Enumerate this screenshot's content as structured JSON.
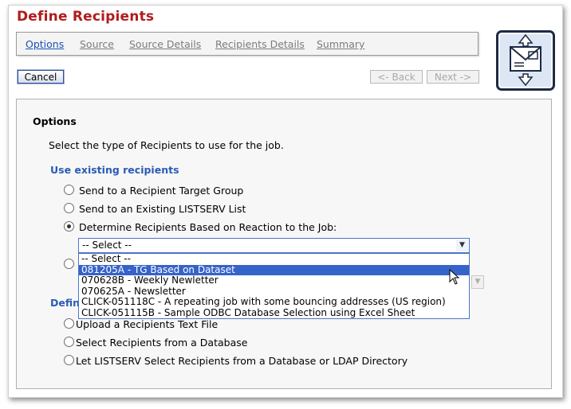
{
  "header": {
    "title": "Define Recipients"
  },
  "tabs": [
    {
      "label": "Options",
      "active": true
    },
    {
      "label": "Source",
      "active": false
    },
    {
      "label": "Source Details",
      "active": false
    },
    {
      "label": "Recipients Details",
      "active": false
    },
    {
      "label": "Summary",
      "active": false
    }
  ],
  "toolbar": {
    "cancel_label": "Cancel",
    "back_label": "<- Back",
    "next_label": "Next ->"
  },
  "main": {
    "section_title": "Options",
    "instruction": "Select the type of Recipients to use for the job.",
    "existing_group": {
      "title": "Use existing recipients",
      "options": [
        {
          "label": "Send to a Recipient Target Group",
          "selected": false
        },
        {
          "label": "Send to an Existing LISTSERV List",
          "selected": false
        },
        {
          "label": "Determine Recipients Based on Reaction to the Job:",
          "selected": true
        }
      ]
    },
    "job_select": {
      "value": "-- Select --",
      "options": [
        "-- Select --",
        "081205A - TG Based on Dataset",
        "070628B - Weekly Newletter",
        "070625A - Newsletter",
        "CLICK-051118C - A repeating job with some bouncing addresses (US region)",
        "CLICK-051115B - Sample ODBC Database Selection using Excel Sheet"
      ],
      "highlighted_index": 1
    },
    "define_group": {
      "title_visible": "Defin",
      "options": [
        {
          "label": "Upload a Recipients Text File",
          "selected": false
        },
        {
          "label": "Select Recipients from a Database",
          "selected": false
        },
        {
          "label": "Let LISTSERV Select Recipients from a Database or LDAP Directory",
          "selected": false
        }
      ]
    }
  },
  "colors": {
    "title": "#b01c1c",
    "link": "#1a4fb5",
    "group_heading": "#2a5bb4",
    "highlight": "#3663c9"
  },
  "icons": {
    "wizard": "envelope-exchange-icon",
    "cursor": "mouse-pointer-icon"
  }
}
